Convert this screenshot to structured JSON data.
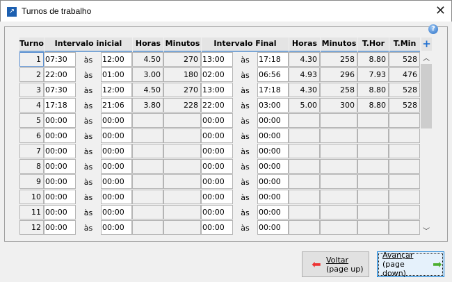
{
  "window": {
    "title": "Turnos de trabalho",
    "close": "✕"
  },
  "help": "?",
  "headers": {
    "turno": "Turno",
    "intervalo_inicial": "Intervalo inicial",
    "horas1": "Horas",
    "minutos1": "Minutos",
    "intervalo_final": "Intervalo Final",
    "horas2": "Horas",
    "minutos2": "Minutos",
    "thor": "T.Hor",
    "tmin": "T.Min",
    "add": "+"
  },
  "sep": "às",
  "rows": [
    {
      "n": "1",
      "a": "07:30",
      "b": "12:00",
      "h1": "4.50",
      "m1": "270",
      "c": "13:00",
      "d": "17:18",
      "h2": "4.30",
      "m2": "258",
      "th": "8.80",
      "tm": "528"
    },
    {
      "n": "2",
      "a": "22:00",
      "b": "01:00",
      "h1": "3.00",
      "m1": "180",
      "c": "02:00",
      "d": "06:56",
      "h2": "4.93",
      "m2": "296",
      "th": "7.93",
      "tm": "476"
    },
    {
      "n": "3",
      "a": "07:30",
      "b": "12:00",
      "h1": "4.50",
      "m1": "270",
      "c": "13:00",
      "d": "17:18",
      "h2": "4.30",
      "m2": "258",
      "th": "8.80",
      "tm": "528"
    },
    {
      "n": "4",
      "a": "17:18",
      "b": "21:06",
      "h1": "3.80",
      "m1": "228",
      "c": "22:00",
      "d": "03:00",
      "h2": "5.00",
      "m2": "300",
      "th": "8.80",
      "tm": "528"
    },
    {
      "n": "5",
      "a": "00:00",
      "b": "00:00",
      "h1": "",
      "m1": "",
      "c": "00:00",
      "d": "00:00",
      "h2": "",
      "m2": "",
      "th": "",
      "tm": ""
    },
    {
      "n": "6",
      "a": "00:00",
      "b": "00:00",
      "h1": "",
      "m1": "",
      "c": "00:00",
      "d": "00:00",
      "h2": "",
      "m2": "",
      "th": "",
      "tm": ""
    },
    {
      "n": "7",
      "a": "00:00",
      "b": "00:00",
      "h1": "",
      "m1": "",
      "c": "00:00",
      "d": "00:00",
      "h2": "",
      "m2": "",
      "th": "",
      "tm": ""
    },
    {
      "n": "8",
      "a": "00:00",
      "b": "00:00",
      "h1": "",
      "m1": "",
      "c": "00:00",
      "d": "00:00",
      "h2": "",
      "m2": "",
      "th": "",
      "tm": ""
    },
    {
      "n": "9",
      "a": "00:00",
      "b": "00:00",
      "h1": "",
      "m1": "",
      "c": "00:00",
      "d": "00:00",
      "h2": "",
      "m2": "",
      "th": "",
      "tm": ""
    },
    {
      "n": "10",
      "a": "00:00",
      "b": "00:00",
      "h1": "",
      "m1": "",
      "c": "00:00",
      "d": "00:00",
      "h2": "",
      "m2": "",
      "th": "",
      "tm": ""
    },
    {
      "n": "11",
      "a": "00:00",
      "b": "00:00",
      "h1": "",
      "m1": "",
      "c": "00:00",
      "d": "00:00",
      "h2": "",
      "m2": "",
      "th": "",
      "tm": ""
    },
    {
      "n": "12",
      "a": "00:00",
      "b": "00:00",
      "h1": "",
      "m1": "",
      "c": "00:00",
      "d": "00:00",
      "h2": "",
      "m2": "",
      "th": "",
      "tm": ""
    }
  ],
  "buttons": {
    "back": {
      "line1": "Voltar",
      "line2": "(page up)"
    },
    "next": {
      "line1": "Avançar",
      "line2": "(page down)"
    }
  }
}
